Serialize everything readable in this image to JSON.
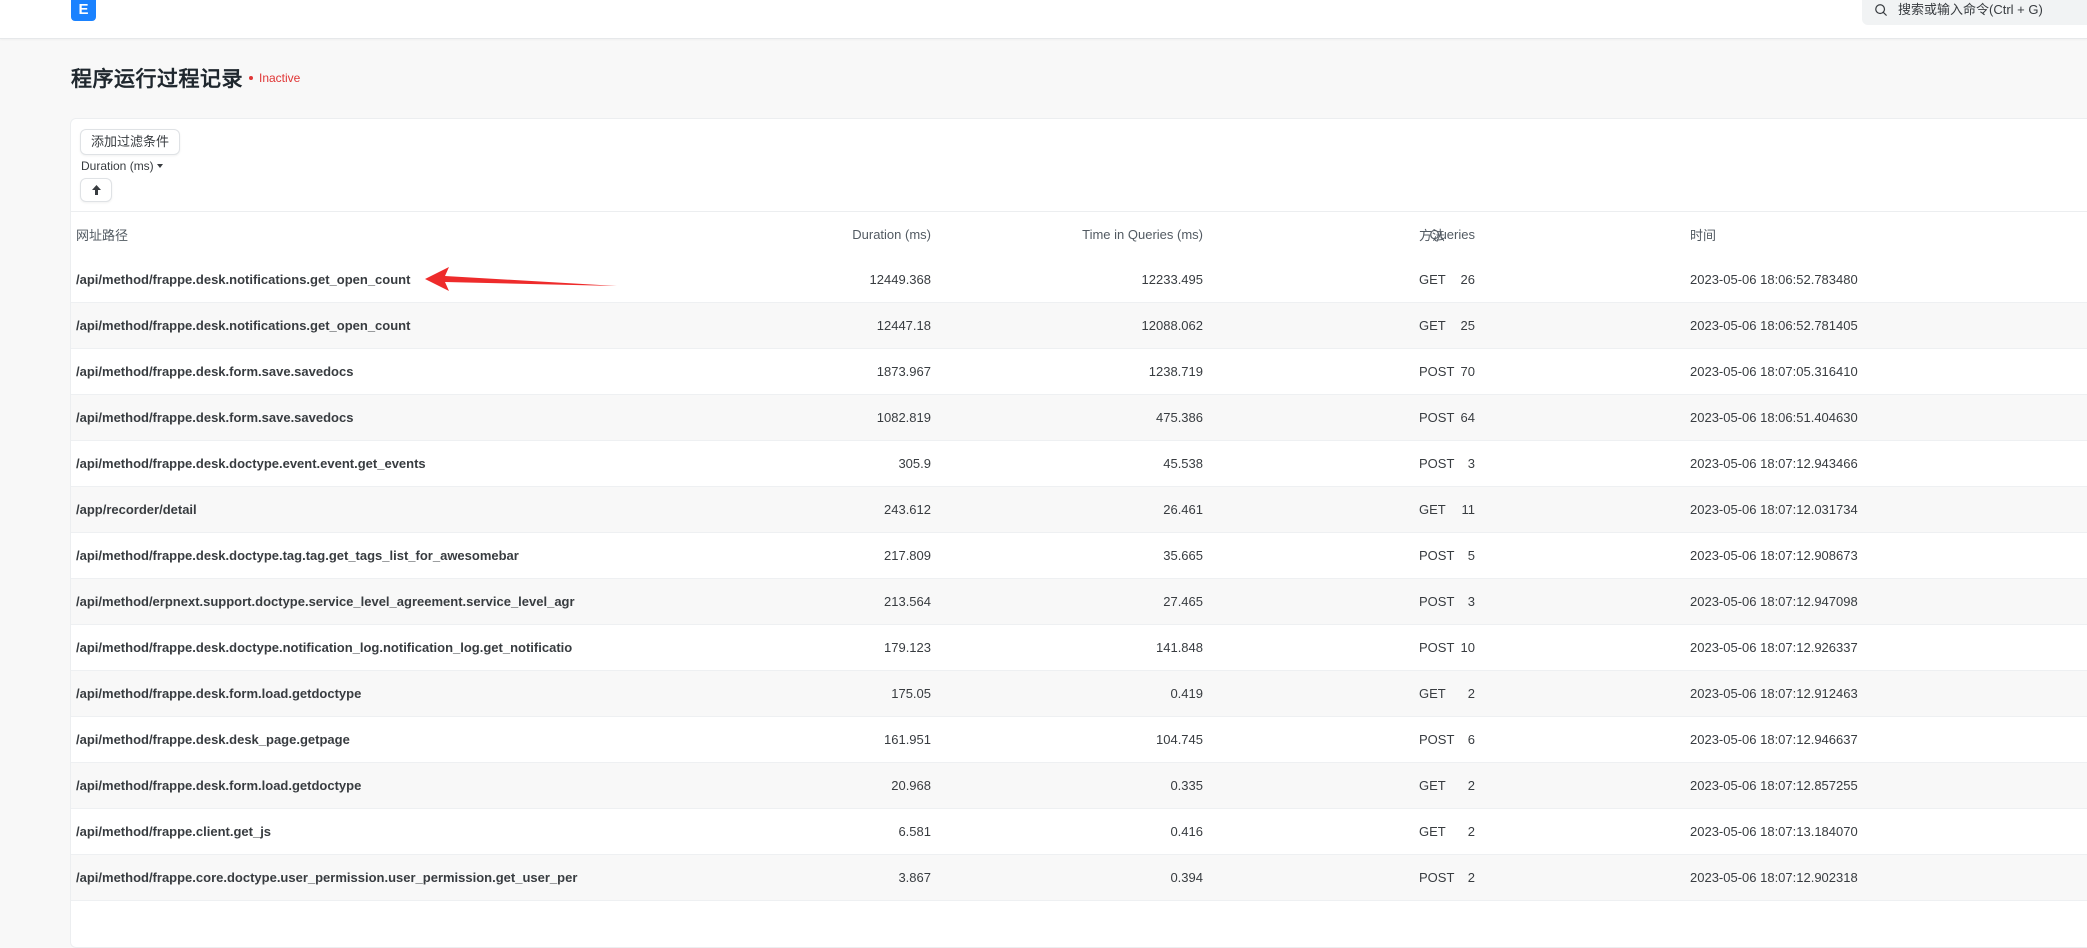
{
  "navbar": {
    "logo_letter": "E",
    "search_placeholder": "搜索或输入命令(Ctrl + G)"
  },
  "page": {
    "title": "程序运行过程记录",
    "status": "Inactive"
  },
  "filters": {
    "add_filter_label": "添加过滤条件",
    "sort_by_label": "Duration (ms)"
  },
  "table": {
    "headers": {
      "path": "网址路径",
      "duration": "Duration (ms)",
      "time_in_queries": "Time in Queries (ms)",
      "queries": "Queries",
      "method": "方法",
      "time": "时间"
    },
    "rows": [
      {
        "path": "/api/method/frappe.desk.notifications.get_open_count",
        "duration": "12449.368",
        "time_in_queries": "12233.495",
        "queries": "26",
        "method": "GET",
        "time": "2023-05-06 18:06:52.783480"
      },
      {
        "path": "/api/method/frappe.desk.notifications.get_open_count",
        "duration": "12447.18",
        "time_in_queries": "12088.062",
        "queries": "25",
        "method": "GET",
        "time": "2023-05-06 18:06:52.781405"
      },
      {
        "path": "/api/method/frappe.desk.form.save.savedocs",
        "duration": "1873.967",
        "time_in_queries": "1238.719",
        "queries": "70",
        "method": "POST",
        "time": "2023-05-06 18:07:05.316410"
      },
      {
        "path": "/api/method/frappe.desk.form.save.savedocs",
        "duration": "1082.819",
        "time_in_queries": "475.386",
        "queries": "64",
        "method": "POST",
        "time": "2023-05-06 18:06:51.404630"
      },
      {
        "path": "/api/method/frappe.desk.doctype.event.event.get_events",
        "duration": "305.9",
        "time_in_queries": "45.538",
        "queries": "3",
        "method": "POST",
        "time": "2023-05-06 18:07:12.943466"
      },
      {
        "path": "/app/recorder/detail",
        "duration": "243.612",
        "time_in_queries": "26.461",
        "queries": "11",
        "method": "GET",
        "time": "2023-05-06 18:07:12.031734"
      },
      {
        "path": "/api/method/frappe.desk.doctype.tag.tag.get_tags_list_for_awesomebar",
        "duration": "217.809",
        "time_in_queries": "35.665",
        "queries": "5",
        "method": "POST",
        "time": "2023-05-06 18:07:12.908673"
      },
      {
        "path": "/api/method/erpnext.support.doctype.service_level_agreement.service_level_agr",
        "duration": "213.564",
        "time_in_queries": "27.465",
        "queries": "3",
        "method": "POST",
        "time": "2023-05-06 18:07:12.947098"
      },
      {
        "path": "/api/method/frappe.desk.doctype.notification_log.notification_log.get_notificatio",
        "duration": "179.123",
        "time_in_queries": "141.848",
        "queries": "10",
        "method": "POST",
        "time": "2023-05-06 18:07:12.926337"
      },
      {
        "path": "/api/method/frappe.desk.form.load.getdoctype",
        "duration": "175.05",
        "time_in_queries": "0.419",
        "queries": "2",
        "method": "GET",
        "time": "2023-05-06 18:07:12.912463"
      },
      {
        "path": "/api/method/frappe.desk.desk_page.getpage",
        "duration": "161.951",
        "time_in_queries": "104.745",
        "queries": "6",
        "method": "POST",
        "time": "2023-05-06 18:07:12.946637"
      },
      {
        "path": "/api/method/frappe.desk.form.load.getdoctype",
        "duration": "20.968",
        "time_in_queries": "0.335",
        "queries": "2",
        "method": "GET",
        "time": "2023-05-06 18:07:12.857255"
      },
      {
        "path": "/api/method/frappe.client.get_js",
        "duration": "6.581",
        "time_in_queries": "0.416",
        "queries": "2",
        "method": "GET",
        "time": "2023-05-06 18:07:13.184070"
      },
      {
        "path": "/api/method/frappe.core.doctype.user_permission.user_permission.get_user_per",
        "duration": "3.867",
        "time_in_queries": "0.394",
        "queries": "2",
        "method": "POST",
        "time": "2023-05-06 18:07:12.902318"
      }
    ]
  },
  "colors": {
    "accent": "#1a82ff",
    "inactive": "#e03636",
    "annotation_arrow": "#ee2b2b"
  }
}
